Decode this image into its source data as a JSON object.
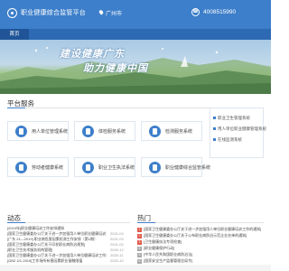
{
  "header": {
    "title": "职业健康综合监管平台",
    "location": "广州市",
    "phone": "4008515990",
    "bg_color": "#3d7fca"
  },
  "nav": {
    "items": [
      {
        "label": "首页"
      },
      {
        "label": ""
      },
      {
        "label": ""
      }
    ]
  },
  "hero": {
    "slogan_line1": "建设健康广东",
    "slogan_line2": "助力健康中国"
  },
  "services": {
    "title": "平台服务",
    "cards": [
      {
        "label": "用人单位管理系统",
        "icon": "building-icon"
      },
      {
        "label": "体检服务系统",
        "icon": "stethoscope-icon"
      },
      {
        "label": "检测服务系统",
        "icon": "flask-icon"
      },
      {
        "label": "劳动者健康系统",
        "icon": "person-icon"
      },
      {
        "label": "职业卫生执法系统",
        "icon": "gavel-icon"
      },
      {
        "label": "职业健康综合监管系统",
        "icon": "shield-icon"
      }
    ],
    "side_links": [
      {
        "label": "职业卫生管理系统"
      },
      {
        "label": "用人单位职业健康管理系统"
      },
      {
        "label": "在线监测系统"
      }
    ]
  },
  "news": {
    "title": "动态",
    "items": [
      {
        "text": "[2019年]职业健康培训工作安排通知",
        "date": ""
      },
      {
        "text": "[国家卫生健康委办公厅关于进一步加强用人单位职业健康培训工作的通知]",
        "date": "2021-04"
      },
      {
        "text": "[广东 21—2019] 职业病危害因素检测工作安排（第1期）",
        "date": "2021-03"
      },
      {
        "text": "[国家卫生健康委办公厅关于印发职业病防治规划]",
        "date": "2021-02"
      },
      {
        "text": "[职业卫生技术服务机构管理]",
        "date": "2020-12"
      },
      {
        "text": "[国家卫生健康委办公厅关于进一步加强用人单位健康培训工作通知]",
        "date": "2020-11"
      },
      {
        "text": "[GBZ 2/1-2019]工作场所有害因素职业接触限值",
        "date": "2020-10"
      }
    ]
  },
  "hot": {
    "title": "热门",
    "items": [
      {
        "rank": "1",
        "text": "[国家卫生健康委办公厅关于进一步加强用人单位职业健康培训工作的通知]"
      },
      {
        "rank": "2",
        "text": "[国家卫生健康委办公厅关于公布职业病防治示范企业名单的通知]"
      },
      {
        "rank": "3",
        "text": "[卫生健康执法专项检查]"
      },
      {
        "rank": "4",
        "text": "[职业健康保护行动]"
      },
      {
        "rank": "5",
        "text": "[中华人民共和国职业病防治法]"
      },
      {
        "rank": "6",
        "text": "[国家安全生产监督管理总局令]"
      }
    ]
  }
}
